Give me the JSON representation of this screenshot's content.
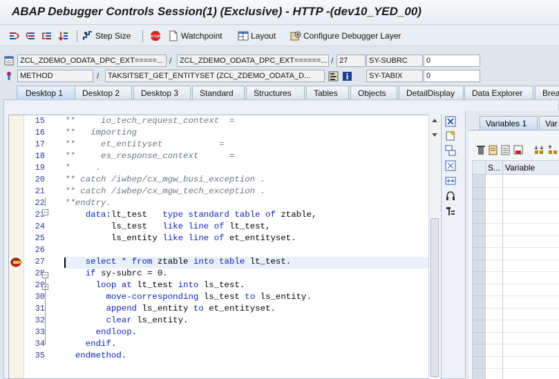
{
  "window": {
    "title": "ABAP Debugger Controls Session(1)  (Exclusive) - HTTP -(dev10_YED_00)"
  },
  "toolbar": {
    "step_icons": [
      "step-into-icon",
      "step-over-icon",
      "return-icon",
      "continue-icon"
    ],
    "step_size_label": "Step Size",
    "watchpoint_label": "Watchpoint",
    "layout_label": "Layout",
    "configure_label": "Configure Debugger Layer"
  },
  "info": {
    "row1": {
      "program": "ZCL_ZDEMO_ODATA_DPC_EXT=====...",
      "include": "ZCL_ZDEMO_ODATA_DPC_EXT======...",
      "line": "27",
      "var_name": "SY-SUBRC",
      "var_value": "0"
    },
    "row2": {
      "event_type": "METHOD",
      "event": "TAKSITSET_GET_ENTITYSET (ZCL_ZDEMO_ODATA_D...",
      "var_name": "SY-TABIX",
      "var_value": "0"
    }
  },
  "tabs": [
    "Desktop 1",
    "Desktop 2",
    "Desktop 3",
    "Standard",
    "Structures",
    "Tables",
    "Objects",
    "DetailDisplay",
    "Data Explorer",
    "Break"
  ],
  "active_tab": "Desktop 1",
  "source": {
    "current_line": 27,
    "lines": [
      {
        "no": "15",
        "text": "**     io_tech_request_context  =",
        "comment": true
      },
      {
        "no": "16",
        "text": "**   importing",
        "comment": true
      },
      {
        "no": "17",
        "text": "**     et_entityset           =",
        "comment": true
      },
      {
        "no": "18",
        "text": "**     es_response_context      =",
        "comment": true
      },
      {
        "no": "19",
        "text": "*     .",
        "comment": true
      },
      {
        "no": "20",
        "text": "** catch /iwbep/cx_mgw_busi_exception .",
        "comment": true
      },
      {
        "no": "21",
        "text": "** catch /iwbep/cx_mgw_tech_exception .",
        "comment": true
      },
      {
        "no": "22",
        "text": "**endtry.",
        "comment": true
      },
      {
        "no": "23",
        "text": "    data:lt_test   type standard table of ztable,",
        "comment": false
      },
      {
        "no": "24",
        "text": "         ls_test   like line of lt_test,",
        "comment": false
      },
      {
        "no": "25",
        "text": "         ls_entity like line of et_entityset.",
        "comment": false
      },
      {
        "no": "26",
        "text": "",
        "comment": false
      },
      {
        "no": "27",
        "text": "    select * from ztable into table lt_test.",
        "comment": false
      },
      {
        "no": "28",
        "text": "    if sy-subrc = 0.",
        "comment": false
      },
      {
        "no": "29",
        "text": "      loop at lt_test into ls_test.",
        "comment": false
      },
      {
        "no": "30",
        "text": "        move-corresponding ls_test to ls_entity.",
        "comment": false
      },
      {
        "no": "31",
        "text": "        append ls_entity to et_entityset.",
        "comment": false
      },
      {
        "no": "32",
        "text": "        clear ls_entity.",
        "comment": false
      },
      {
        "no": "33",
        "text": "      endloop.",
        "comment": false
      },
      {
        "no": "34",
        "text": "    endif.",
        "comment": false
      },
      {
        "no": "35",
        "text": "  endmethod.",
        "comment": false
      }
    ]
  },
  "right_panel": {
    "tabs": [
      "Variables 1",
      "Var"
    ],
    "active_tab": "Variables 1",
    "columns": [
      "S...",
      "Variable"
    ]
  },
  "colors": {
    "keyword": "#0a23b5",
    "comment": "#6c7581",
    "line_number": "#2a3a8c"
  }
}
